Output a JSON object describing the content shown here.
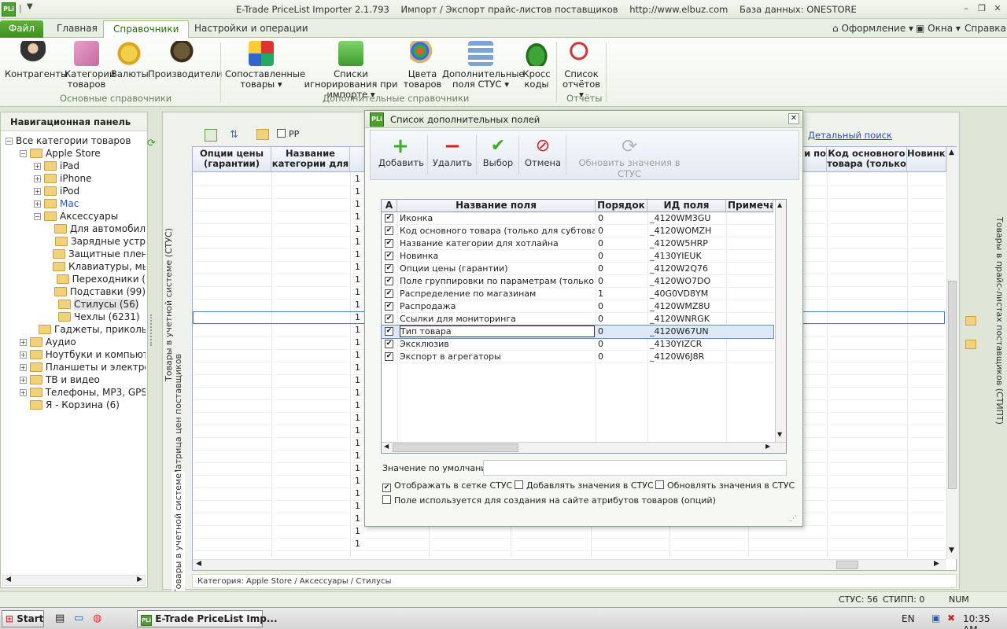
{
  "titlebar": {
    "app_title": "E-Trade PriceList Importer 2.1.793",
    "subtitle": "Импорт / Экспорт прайс-листов поставщиков",
    "url": "http://www.elbuz.com",
    "database": "База данных: ONESTORE",
    "logo": "PLi",
    "minimize": "–",
    "restore": "❐",
    "close": "✕"
  },
  "tabs": {
    "file": "Файл",
    "home": "Главная",
    "references": "Справочники",
    "settings": "Настройки и операции"
  },
  "right_menu": {
    "appearance": "Оформление",
    "windows": "Окна",
    "help": "Справка"
  },
  "ribbon": {
    "counterparties": "Контрагенты",
    "categories": "Категории товаров",
    "currencies": "Валюты",
    "manufacturers": "Производители",
    "group1": "Основные справочники",
    "matched": "Сопоставленные товары",
    "ignore_lists": "Списки игнорирования при импорте",
    "colors": "Цвета товаров",
    "extra_fields": "Дополнительные поля СТУС",
    "cross_codes": "Кросс коды",
    "group2": "Дополнительные справочники",
    "report_list": "Список отчётов",
    "group3": "Отчёты"
  },
  "nav": {
    "header": "Навигационная панель",
    "items": [
      {
        "label": "Все категории товаров",
        "level": 0,
        "exp": "−"
      },
      {
        "label": "Apple Store",
        "level": 1,
        "exp": "−"
      },
      {
        "label": "iPad",
        "level": 2,
        "exp": "+"
      },
      {
        "label": "iPhone",
        "level": 2,
        "exp": "+"
      },
      {
        "label": "iPod",
        "level": 2,
        "exp": "+"
      },
      {
        "label": "Mac",
        "level": 2,
        "exp": "+"
      },
      {
        "label": "Аксессуары",
        "level": 2,
        "exp": "−"
      },
      {
        "label": "Для автомобил",
        "level": 3,
        "exp": ""
      },
      {
        "label": "Зарядные устр",
        "level": 3,
        "exp": ""
      },
      {
        "label": "Защитные плен",
        "level": 3,
        "exp": ""
      },
      {
        "label": "Клавиатуры, мы",
        "level": 3,
        "exp": ""
      },
      {
        "label": "Переходники (",
        "level": 3,
        "exp": ""
      },
      {
        "label": "Подставки (99)",
        "level": 3,
        "exp": ""
      },
      {
        "label": "Стилусы (56)",
        "level": 3,
        "exp": ""
      },
      {
        "label": "Чехлы (6231)",
        "level": 3,
        "exp": ""
      },
      {
        "label": "Гаджеты, приколь",
        "level": 2,
        "exp": ""
      },
      {
        "label": "Аудио",
        "level": 1,
        "exp": "+"
      },
      {
        "label": "Ноутбуки и компьюте",
        "level": 1,
        "exp": "+"
      },
      {
        "label": "Планшеты и электрон",
        "level": 1,
        "exp": "+"
      },
      {
        "label": "ТВ и видео",
        "level": 1,
        "exp": "+"
      },
      {
        "label": "Телефоны, MP3, GPS",
        "level": 1,
        "exp": "+"
      },
      {
        "label": "Я - Корзина (6)",
        "level": 1,
        "exp": ""
      }
    ]
  },
  "main": {
    "pp_label": "PP",
    "detailed_search": "Детальный поиск",
    "columns": [
      "Опции цены (гарантии)",
      "Название категории для",
      "",
      "",
      "",
      "",
      "и по",
      "Код основного товара (только",
      "Новинка"
    ],
    "row_value": "1",
    "side_tab_1": "Товары в учетной системе (СТУС)",
    "side_tab_2": "Матрица цен поставщиков",
    "side_tab_3": "Товары в учетной системе",
    "right_vertical": "Товары в прайс-листах поставщиков (СТИПТ)",
    "category_path": "Категория: Apple Store / Аксессуары / Стилусы"
  },
  "dialog": {
    "title": "Список дополнительных полей",
    "toolbar": {
      "add": "Добавить",
      "delete": "Удалить",
      "select": "Выбор",
      "cancel": "Отмена",
      "refresh": "Обновить значения в СТУС"
    },
    "headers": {
      "a": "А",
      "name": "Название поля",
      "order": "Порядок",
      "id": "ИД поля",
      "note": "Примечан"
    },
    "rows": [
      {
        "checked": "✔",
        "name": "Иконка",
        "order": "0",
        "id": "_4120WM3GU"
      },
      {
        "checked": "✔",
        "name": "Код основного товара (только для субтоваров)",
        "order": "0",
        "id": "_4120WOMZH"
      },
      {
        "checked": "✔",
        "name": "Название категории для хотлайна",
        "order": "0",
        "id": "_4120W5HRP"
      },
      {
        "checked": "✔",
        "name": "Новинка",
        "order": "0",
        "id": "_4130YIEUK"
      },
      {
        "checked": "✔",
        "name": "Опции цены (гарантии)",
        "order": "0",
        "id": "_4120W2Q76"
      },
      {
        "checked": "✔",
        "name": "Поле группировки по параметрам (только для эг",
        "order": "0",
        "id": "_4120WO7DO"
      },
      {
        "checked": "✔",
        "name": "Распределение по магазинам",
        "order": "1",
        "id": "_40G0VD8YM"
      },
      {
        "checked": "✔",
        "name": "Распродажа",
        "order": "0",
        "id": "_4120WMZ8U"
      },
      {
        "checked": "✔",
        "name": "Ссылки для мониторинга",
        "order": "0",
        "id": "_4120WNRGK"
      },
      {
        "checked": "✔",
        "name": "Тип товара",
        "order": "0",
        "id": "_4120W67UN"
      },
      {
        "checked": "✔",
        "name": "Эксклюзив",
        "order": "0",
        "id": "_4130YIZCR"
      },
      {
        "checked": "✔",
        "name": "Экспорт в агрегаторы",
        "order": "0",
        "id": "_4120W6J8R"
      }
    ],
    "default_value_label": "Значение по умолчанию:",
    "show_in_grid": "Отображать в сетке СТУС",
    "add_values": "Добавлять значения в СТУС",
    "update_values": "Обновлять значения в СТУС",
    "used_for_attrs": "Поле используется для создания на сайте атрибутов товаров (опций)",
    "show_in_grid_checked": "✔",
    "add_values_checked": "",
    "update_values_checked": "",
    "used_for_attrs_checked": ""
  },
  "statusbar": {
    "stus": "СТУС: 56",
    "stipt": "СТИПП: 0",
    "num": "NUM"
  },
  "taskbar": {
    "start": "Start",
    "task": "E-Trade PriceList Imp...",
    "lang": "EN",
    "time": "10:35 AM"
  },
  "colors": {
    "accent": "#4ea12f",
    "selection": "#dbe8f7"
  }
}
